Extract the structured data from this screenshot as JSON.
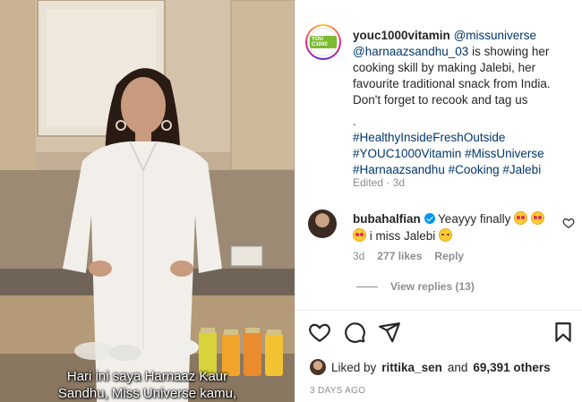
{
  "media": {
    "caption_line1": "Hari ini saya Harnaaz Kaur",
    "caption_line2": "Sandhu, Miss Universe kamu,"
  },
  "post": {
    "author": "youc1000vitamin",
    "avatar_logo_text": "YOU C1000",
    "mention1": "@missuniverse",
    "mention2": "@harnaazsandhu_03",
    "caption_text": "is showing her cooking skill by making Jalebi, her favourite traditional snack from India. Don't forget to recook and tag us",
    "dot": ".",
    "hashtag1": "#HealthyInsideFreshOutside",
    "hashtag2": "#YOUC1000Vitamin",
    "hashtag3": "#MissUniverse",
    "hashtag4": "#Harnaazsandhu",
    "hashtag5": "#Cooking",
    "hashtag6": "#Jalebi",
    "meta": "Edited · 3d"
  },
  "comment": {
    "user": "bubahalfian",
    "text_part1": "Yeayyy finally",
    "text_part2": "i miss Jalebi",
    "time": "3d",
    "likes": "277 likes",
    "reply_label": "Reply",
    "view_replies": "View replies (13)"
  },
  "footer": {
    "liked_by_prefix": "Liked by",
    "liked_by_user": "rittika_sen",
    "liked_by_and": "and",
    "liked_by_others": "69,391 others",
    "time_ago": "3 DAYS AGO"
  },
  "icons": {
    "like": "heart-icon",
    "comment": "comment-icon",
    "share": "share-icon",
    "save": "bookmark-icon",
    "comment_like": "heart-small-icon"
  },
  "colors": {
    "link": "#00376b",
    "text": "#262626",
    "muted": "#8e8e8e",
    "verified": "#0095f6"
  }
}
